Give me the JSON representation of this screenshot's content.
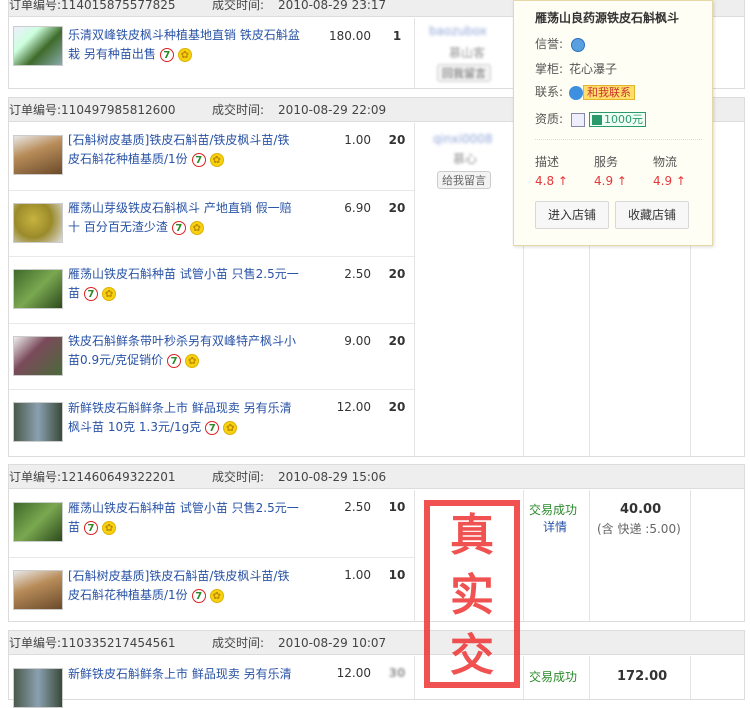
{
  "labels": {
    "order_no": "订单编号:",
    "deal_time": "成交时间:"
  },
  "orders": [
    {
      "no": "114015875577825",
      "time": "2010-08-29 23:17",
      "items": [
        {
          "title": "乐清双峰铁皮枫斗种植基地直销 铁皮石斛盆栽 另有种苗出售",
          "price": "180.00",
          "qty": "1"
        }
      ],
      "buyer": {
        "name": "baozubox",
        "sub": "慕山客",
        "btn": "回我留言"
      }
    },
    {
      "no": "110497985812600",
      "time": "2010-08-29 22:09",
      "items": [
        {
          "title": "[石斛树皮基质]铁皮石斛苗/铁皮枫斗苗/铁皮石斛花种植基质/1份",
          "price": "1.00",
          "qty": "20"
        },
        {
          "title": "雁荡山芽级铁皮石斛枫斗 产地直销 假一赔十 百分百无渣少渣",
          "price": "6.90",
          "qty": "20"
        },
        {
          "title": "雁荡山铁皮石斛种苗 试管小苗 只售2.5元一苗",
          "price": "2.50",
          "qty": "20"
        },
        {
          "title": "铁皮石斛鲜条带叶秒杀另有双峰特产枫斗小苗0.9元/克促销价",
          "price": "9.00",
          "qty": "20"
        },
        {
          "title": "新鲜铁皮石斛鲜条上市 鲜品现卖 另有乐清枫斗苗 10克 1.3元/1g克",
          "price": "12.00",
          "qty": "20"
        }
      ],
      "buyer": {
        "name": "qinxi0008",
        "sub": "慕心",
        "btn": "给我留言"
      }
    },
    {
      "no": "121460649322201",
      "time": "2010-08-29 15:06",
      "items": [
        {
          "title": "雁荡山铁皮石斛种苗 试管小苗 只售2.5元一苗",
          "price": "2.50",
          "qty": "10"
        },
        {
          "title": "[石斛树皮基质]铁皮石斛苗/铁皮枫斗苗/铁皮石斛花种植基质/1份",
          "price": "1.00",
          "qty": "10"
        }
      ],
      "status": "交易成功",
      "detail": "详情",
      "total": "40.00",
      "shipping": "(含 快递 :5.00)"
    },
    {
      "no": "110335217454561",
      "time": "2010-08-29 10:07",
      "items": [
        {
          "title": "新鲜铁皮石斛鲜条上市 鲜品现卖 另有乐清",
          "price": "12.00",
          "qty": "30"
        }
      ],
      "status": "交易成功",
      "total": "172.00"
    }
  ],
  "popup": {
    "shop_name": "雁荡山良药源铁皮石斛枫斗",
    "credit_label": "信誉:",
    "keeper_label": "掌柜:",
    "keeper": "花心瀑子",
    "contact_label": "联系:",
    "contact_btn": "和我联系",
    "qual_label": "资质:",
    "deposit": "1000元",
    "scores": [
      {
        "label": "描述",
        "value": "4.8"
      },
      {
        "label": "服务",
        "value": "4.9"
      },
      {
        "label": "物流",
        "value": "4.9"
      }
    ],
    "enter_btn": "进入店铺",
    "fav_btn": "收藏店铺"
  },
  "stamp_text": "真实交"
}
